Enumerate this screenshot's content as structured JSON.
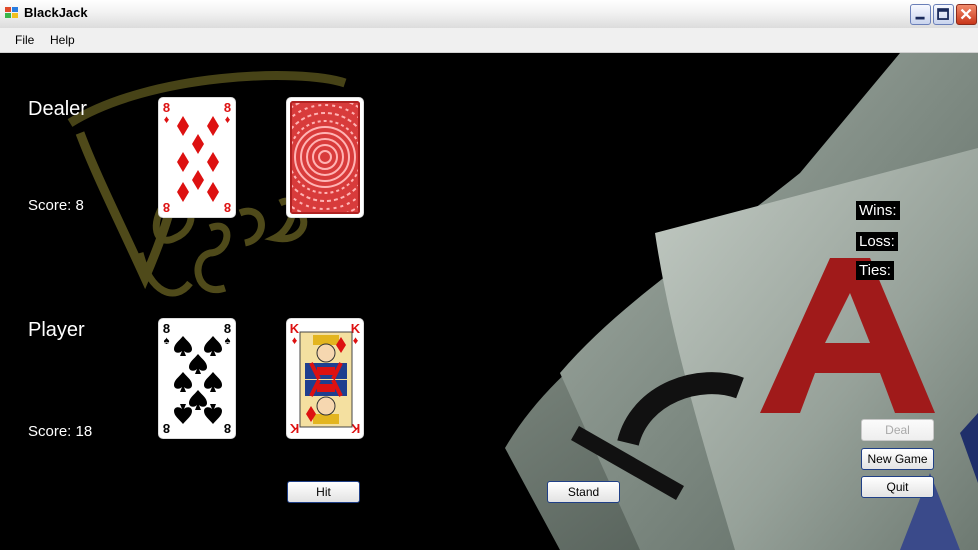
{
  "window": {
    "title": "BlackJack"
  },
  "menu": {
    "items": [
      "File",
      "Help"
    ]
  },
  "dealer": {
    "label": "Dealer",
    "score_text": "Score: 8",
    "cards": [
      {
        "rank": "8",
        "suit": "♦",
        "color": "#d11",
        "face_up": true
      },
      {
        "face_up": false
      }
    ]
  },
  "player": {
    "label": "Player",
    "score_text": "Score: 18",
    "cards": [
      {
        "rank": "8",
        "suit": "♠",
        "color": "#000",
        "face_up": true
      },
      {
        "rank": "K",
        "suit": "♦",
        "color": "#d11",
        "face_up": true
      }
    ]
  },
  "stats": {
    "wins": "Wins:",
    "loss": "Loss:",
    "ties": "Ties:"
  },
  "buttons": {
    "hit": "Hit",
    "stand": "Stand",
    "deal": "Deal",
    "new_game": "New Game",
    "quit": "Quit"
  },
  "background": {
    "watermark": "Vegas",
    "ace_rank": "A"
  },
  "colors": {
    "card_red": "#d11",
    "back_red": "#d83b3b",
    "button_border": "#1f3f87",
    "ace_red": "#a01a1a",
    "watermark": "#4f4a1a"
  }
}
